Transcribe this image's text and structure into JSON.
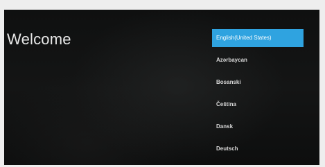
{
  "welcome": {
    "title": "Welcome"
  },
  "languages": {
    "items": [
      {
        "label": "English(United States)",
        "selected": true
      },
      {
        "label": "Azərbaycan",
        "selected": false
      },
      {
        "label": "Bosanski",
        "selected": false
      },
      {
        "label": "Čeština",
        "selected": false
      },
      {
        "label": "Dansk",
        "selected": false
      },
      {
        "label": "Deutsch",
        "selected": false
      }
    ]
  },
  "colors": {
    "accent": "#2fa3e0",
    "background": "#121313",
    "text": "#e8e8e8"
  }
}
